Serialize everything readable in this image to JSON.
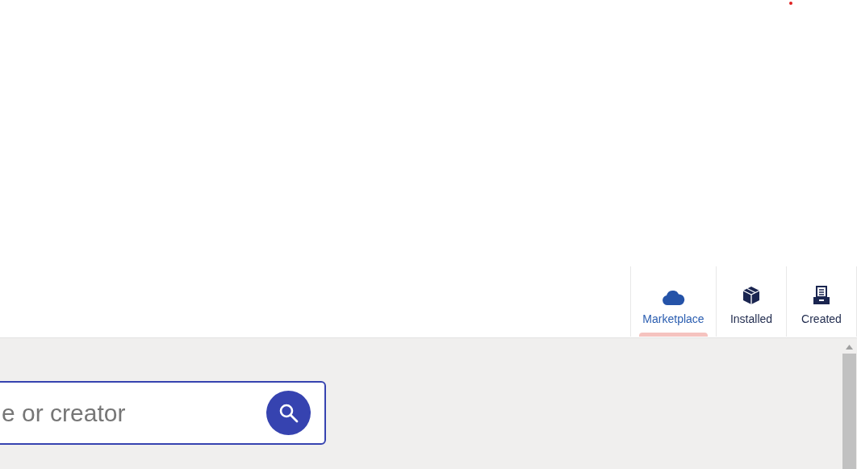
{
  "tabs": [
    {
      "label": "Marketplace",
      "kind": "cloud",
      "selected": true
    },
    {
      "label": "Installed",
      "kind": "box",
      "selected": false
    },
    {
      "label": "Created",
      "kind": "drawer",
      "selected": false
    }
  ],
  "search": {
    "placeholder": "e or creator"
  }
}
